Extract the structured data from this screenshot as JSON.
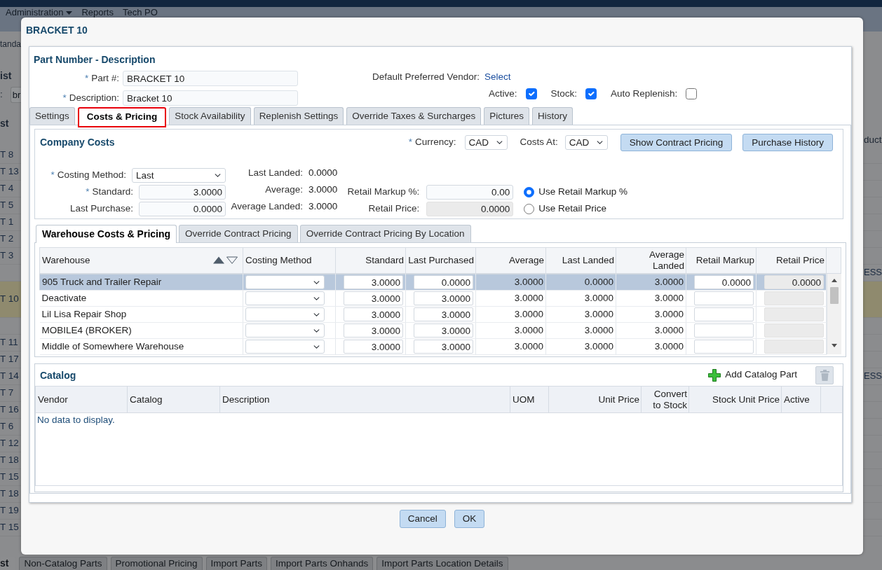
{
  "page_behind": {
    "menu": [
      {
        "label": "Administration",
        "dropdown": true
      },
      {
        "label": "Reports",
        "dropdown": false
      },
      {
        "label": "Tech PO",
        "dropdown": false
      }
    ],
    "side_label": "tanda",
    "list_title": "ist",
    "filter": {
      "label": ":",
      "value": "br"
    },
    "column_header": "st",
    "right_column_header": "duct",
    "rows": [
      {
        "left": "T 8",
        "highlighted": false
      },
      {
        "left": "T 13",
        "highlighted": false
      },
      {
        "left": "T 4",
        "highlighted": false
      },
      {
        "left": "T 5",
        "highlighted": false
      },
      {
        "left": "T 1",
        "highlighted": false
      },
      {
        "left": "T 2",
        "highlighted": false
      },
      {
        "left": "T 3",
        "highlighted": false
      },
      {
        "right": "ESS",
        "highlighted": false
      },
      {
        "left": "T 10",
        "highlighted": true
      },
      {
        "highlighted": false
      },
      {
        "left": "T 11",
        "highlighted": false
      },
      {
        "left": "T 17",
        "highlighted": false
      },
      {
        "left": "T 14",
        "right": "ESS",
        "highlighted": false
      },
      {
        "left": "T 7",
        "highlighted": false
      },
      {
        "left": "T 16",
        "highlighted": false
      },
      {
        "left": "T 6",
        "highlighted": false
      },
      {
        "left": "T 12",
        "highlighted": false
      },
      {
        "left": "T 18",
        "highlighted": false
      },
      {
        "left": "T 15",
        "highlighted": false
      },
      {
        "left": "T 18",
        "highlighted": false
      },
      {
        "left": "T 19",
        "highlighted": false
      },
      {
        "left": "T 15",
        "highlighted": false
      }
    ],
    "tabs": [
      {
        "label": "st",
        "selected": true
      },
      {
        "label": "Non-Catalog Parts",
        "selected": false
      },
      {
        "label": "Promotional Pricing",
        "selected": false
      },
      {
        "label": "Import Parts",
        "selected": false
      },
      {
        "label": "Import Parts Onhands",
        "selected": false
      },
      {
        "label": "Import Parts Location Details",
        "selected": false
      }
    ]
  },
  "dialog": {
    "title": "BRACKET 10",
    "section_title": "Part Number - Description",
    "fields": [
      {
        "mark": "*",
        "label": "Part #:",
        "value": "BRACKET 10"
      },
      {
        "mark": "*",
        "label": "Description:",
        "value": "Bracket 10"
      }
    ],
    "vendor": {
      "label": "Default Preferred Vendor:",
      "link": "Select"
    },
    "flags": [
      {
        "label": "Active:",
        "checked": true
      },
      {
        "label": "Stock:",
        "checked": true
      },
      {
        "label": "Auto Replenish:",
        "checked": false
      }
    ],
    "tabs": [
      {
        "label": "Settings",
        "selected": false,
        "highlighted": false
      },
      {
        "label": "Costs & Pricing",
        "selected": true,
        "highlighted": true
      },
      {
        "label": "Stock Availability",
        "selected": false,
        "highlighted": false
      },
      {
        "label": "Replenish Settings",
        "selected": false,
        "highlighted": false
      },
      {
        "label": "Override Taxes & Surcharges",
        "selected": false,
        "highlighted": false
      },
      {
        "label": "Pictures",
        "selected": false,
        "highlighted": false
      },
      {
        "label": "History",
        "selected": false,
        "highlighted": false
      }
    ],
    "company_costs": {
      "title": "Company Costs",
      "currency": {
        "mark": "*",
        "label": "Currency:",
        "value": "CAD"
      },
      "costs_at": {
        "label": "Costs At:",
        "value": "CAD"
      },
      "buttons": [
        "Show Contract Pricing",
        "Purchase History"
      ],
      "costing_method": {
        "mark": "*",
        "label": "Costing Method:",
        "value": "Last"
      },
      "inputs": [
        {
          "mark": "*",
          "label": "Standard:",
          "value": "3.0000"
        },
        {
          "label": "Last Purchase:",
          "value": "0.0000"
        }
      ],
      "readouts": [
        {
          "label": "Last Landed:",
          "value": "0.0000"
        },
        {
          "label": "Average:",
          "value": "3.0000"
        },
        {
          "label": "Average Landed:",
          "value": "3.0000"
        }
      ],
      "retail_fields": [
        {
          "label": "Retail Markup %:",
          "value": "0.00",
          "disabled": false
        },
        {
          "label": "Retail Price:",
          "value": "0.0000",
          "disabled": true
        }
      ],
      "retail_options": [
        {
          "label": "Use Retail Markup %",
          "selected": true
        },
        {
          "label": "Use Retail Price",
          "selected": false
        }
      ]
    },
    "warehouse": {
      "tabs": [
        {
          "label": "Warehouse Costs & Pricing",
          "selected": true
        },
        {
          "label": "Override Contract Pricing",
          "selected": false
        },
        {
          "label": "Override Contract Pricing By Location",
          "selected": false
        }
      ],
      "columns": [
        {
          "label": "Warehouse",
          "kind": "text",
          "sortable": true
        },
        {
          "label": "Costing Method",
          "kind": "select",
          "sortable": false
        },
        {
          "label": "Standard",
          "kind": "input",
          "sortable": false
        },
        {
          "label": "Last Purchased",
          "kind": "input",
          "sortable": false
        },
        {
          "label": "Average",
          "kind": "number",
          "sortable": false
        },
        {
          "label": "Last Landed",
          "kind": "number",
          "sortable": false
        },
        {
          "label": "Average Landed",
          "kind": "number",
          "sortable": false
        },
        {
          "label": "Retail Markup",
          "kind": "input",
          "sortable": false
        },
        {
          "label": "Retail Price",
          "kind": "readonly",
          "sortable": false
        }
      ],
      "rows": [
        {
          "warehouse": "905 Truck and Trailer Repair",
          "selected": true,
          "standard": "3.0000",
          "last_purchased": "0.0000",
          "average": "3.0000",
          "last_landed": "0.0000",
          "average_landed": "3.0000",
          "retail_markup": "0.0000",
          "retail_price": "0.0000"
        },
        {
          "warehouse": "Deactivate",
          "selected": false,
          "standard": "3.0000",
          "last_purchased": "3.0000",
          "average": "3.0000",
          "last_landed": "3.0000",
          "average_landed": "3.0000"
        },
        {
          "warehouse": "Lil Lisa Repair Shop",
          "selected": false,
          "standard": "3.0000",
          "last_purchased": "3.0000",
          "average": "3.0000",
          "last_landed": "3.0000",
          "average_landed": "3.0000"
        },
        {
          "warehouse": "MOBILE4 (BROKER)",
          "selected": false,
          "standard": "3.0000",
          "last_purchased": "3.0000",
          "average": "3.0000",
          "last_landed": "3.0000",
          "average_landed": "3.0000"
        },
        {
          "warehouse": "Middle of Somewhere Warehouse",
          "selected": false,
          "standard": "3.0000",
          "last_purchased": "3.0000",
          "average": "3.0000",
          "last_landed": "3.0000",
          "average_landed": "3.0000"
        }
      ]
    },
    "catalog": {
      "title": "Catalog",
      "add_button": "Add Catalog Part",
      "delete_disabled": true,
      "columns": [
        {
          "label": "Vendor",
          "kind": "text"
        },
        {
          "label": "Catalog",
          "kind": "text"
        },
        {
          "label": "Description",
          "kind": "text"
        },
        {
          "label": "UOM",
          "kind": "text"
        },
        {
          "label": "Unit Price",
          "kind": "number"
        },
        {
          "label": "Convert to Stock",
          "kind": "number"
        },
        {
          "label": "Stock Unit Price",
          "kind": "number"
        },
        {
          "label": "Active",
          "kind": "text"
        }
      ],
      "empty_text": "No data to display."
    },
    "buttons": [
      "Cancel",
      "OK"
    ]
  }
}
